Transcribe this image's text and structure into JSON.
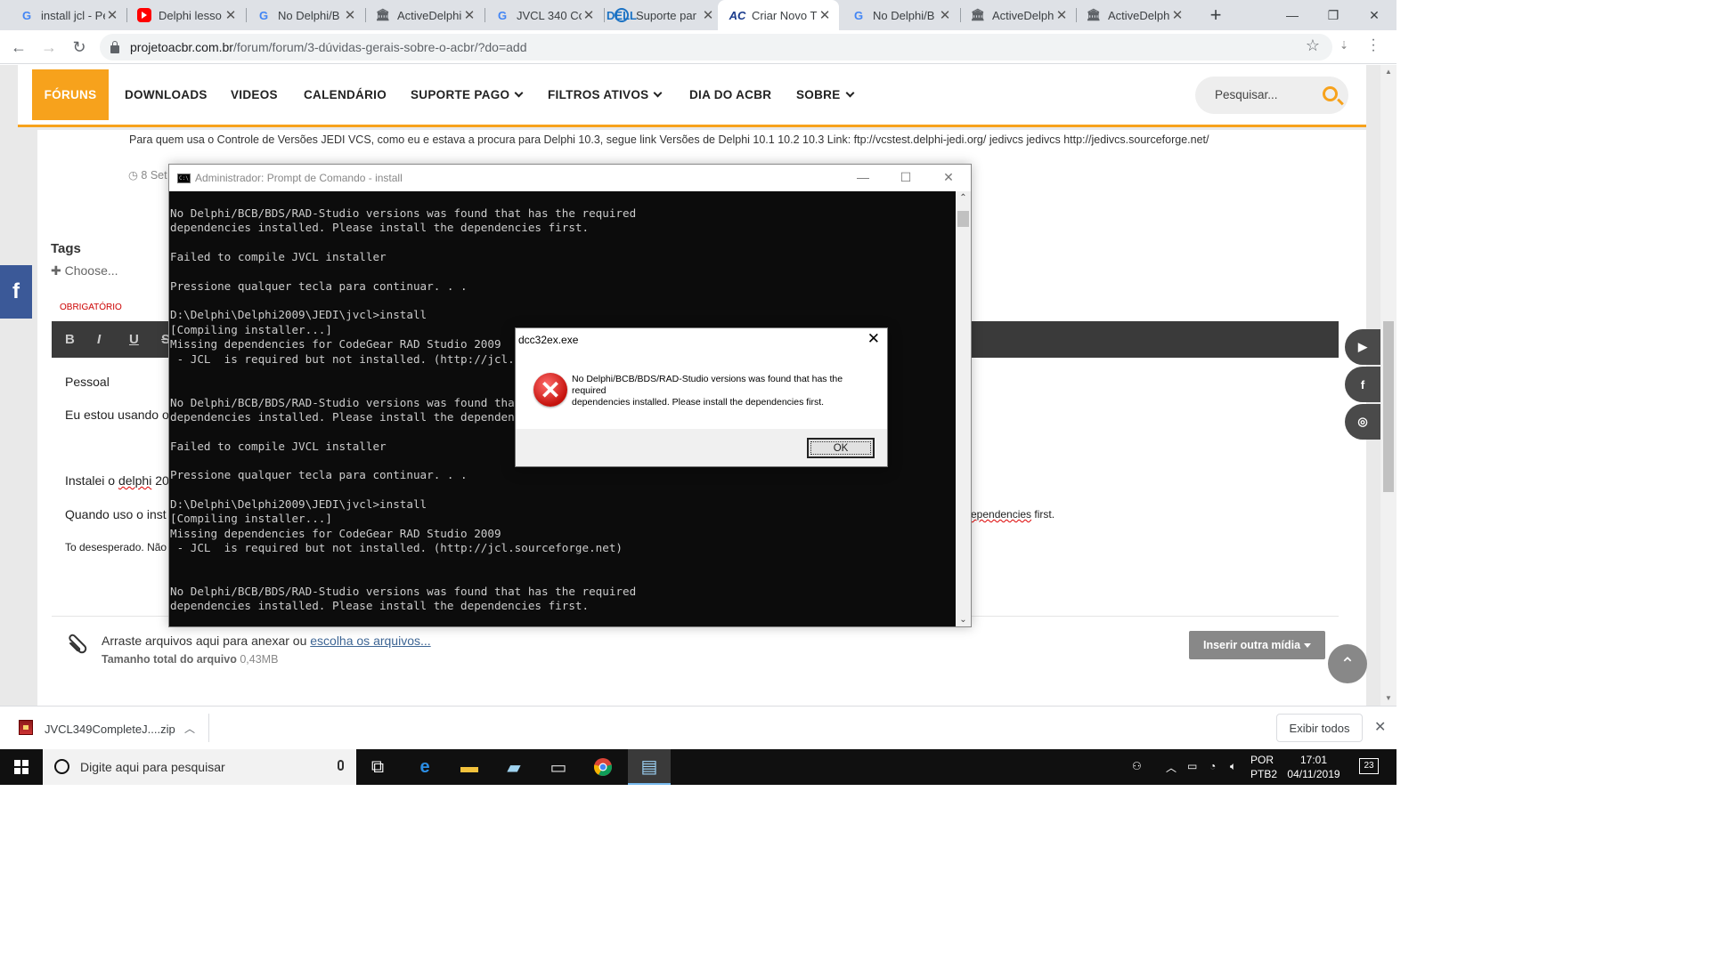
{
  "browser": {
    "tabs": [
      {
        "title": "install jcl - Pe",
        "icon": "google-icon"
      },
      {
        "title": "Delphi lesso",
        "icon": "youtube-icon"
      },
      {
        "title": "No Delphi/B",
        "icon": "google-icon"
      },
      {
        "title": "ActiveDelphi",
        "icon": "museum-icon"
      },
      {
        "title": "JVCL 340 Co",
        "icon": "google-icon"
      },
      {
        "title": "Suporte par",
        "icon": "dell-icon"
      },
      {
        "title": "Criar Novo T",
        "icon": "acbr-icon"
      },
      {
        "title": "No Delphi/B",
        "icon": "google-icon"
      },
      {
        "title": "ActiveDelphi",
        "icon": "museum-icon"
      },
      {
        "title": "ActiveDelphi",
        "icon": "museum-icon"
      }
    ],
    "active_tab_index": 6,
    "url_host": "projetoacbr.com.br",
    "url_path": "/forum/forum/3-dúvidas-gerais-sobre-o-acbr/?do=add"
  },
  "site": {
    "nav": {
      "active": "FÓRUNS",
      "items": [
        "DOWNLOADS",
        "VIDEOS",
        "CALENDÁRIO",
        "SUPORTE PAGO",
        "FILTROS ATIVOS",
        "DIA DO ACBR",
        "SOBRE"
      ],
      "search_placeholder": "Pesquisar..."
    },
    "post_text": "Para quem usa o Controle de Versões JEDI VCS, como eu e estava a procura para Delphi 10.3, segue link Versões de Delphi 10.1 10.2 10.3 Link: ftp://vcstest.delphi-jedi.org/ jedivcs jedivcs http://jedivcs.sourceforge.net/",
    "post_date": "8 Set",
    "tags_title": "Tags",
    "choose_label": "Choose...",
    "required_label": "OBRIGATÓRIO",
    "editor_buttons": [
      "B",
      "I",
      "U",
      "S"
    ],
    "editor_lines": {
      "l1": "Pessoal",
      "l2": "Eu estou usando o",
      "l3_prefix": "Instalei o ",
      "l3_word": "delphi",
      "l3_suffix": " 20",
      "l4_prefix": "Quando uso o inst",
      "l4_tail_word": "ependencies",
      "l4_tail_rest": " first.",
      "l5": "To desesperado. Não"
    },
    "attach": {
      "prompt": "Arraste arquivos aqui para anexar ou",
      "link": "escolha os arquivos...",
      "size_label": "Tamanho total do arquivo",
      "size_value": "0,43MB",
      "insert_button": "Inserir outra mídia"
    }
  },
  "cmd": {
    "title": "Administrador: Prompt de Comando - install",
    "lines": [
      "No Delphi/BCB/BDS/RAD-Studio versions was found that has the required",
      "dependencies installed. Please install the dependencies first.",
      "",
      "Failed to compile JVCL installer",
      "",
      "Pressione qualquer tecla para continuar. . .",
      "",
      "D:\\Delphi\\Delphi2009\\JEDI\\jvcl>install",
      "[Compiling installer...]",
      "Missing dependencies for CodeGear RAD Studio 2009",
      " - JCL  is required but not installed. (http://jcl.sourceforge.net)",
      "",
      "",
      "No Delphi/BCB/BDS/RAD-Studio versions was found that has the required",
      "dependencies installed. Please install the dependencies first.",
      "",
      "Failed to compile JVCL installer",
      "",
      "Pressione qualquer tecla para continuar. . .",
      "",
      "D:\\Delphi\\Delphi2009\\JEDI\\jvcl>install",
      "[Compiling installer...]",
      "Missing dependencies for CodeGear RAD Studio 2009",
      " - JCL  is required but not installed. (http://jcl.sourceforge.net)",
      "",
      "",
      "No Delphi/BCB/BDS/RAD-Studio versions was found that has the required",
      "dependencies installed. Please install the dependencies first."
    ]
  },
  "dialog": {
    "title": "dcc32ex.exe",
    "message_l1": "No Delphi/BCB/BDS/RAD-Studio versions was found that has the required",
    "message_l2": "dependencies installed. Please install the dependencies first.",
    "ok": "OK",
    "icon": "error-icon"
  },
  "downloads": {
    "file": "JVCL349CompleteJ....zip",
    "show_all": "Exibir todos"
  },
  "taskbar": {
    "search_placeholder": "Digite aqui para pesquisar",
    "lang_l1": "POR",
    "lang_l2": "PTB2",
    "time": "17:01",
    "date": "04/11/2019",
    "notifications": "23"
  },
  "colors": {
    "accent": "#f7a21c",
    "console_bg": "#0c0c0c",
    "console_fg": "#cccccc"
  }
}
